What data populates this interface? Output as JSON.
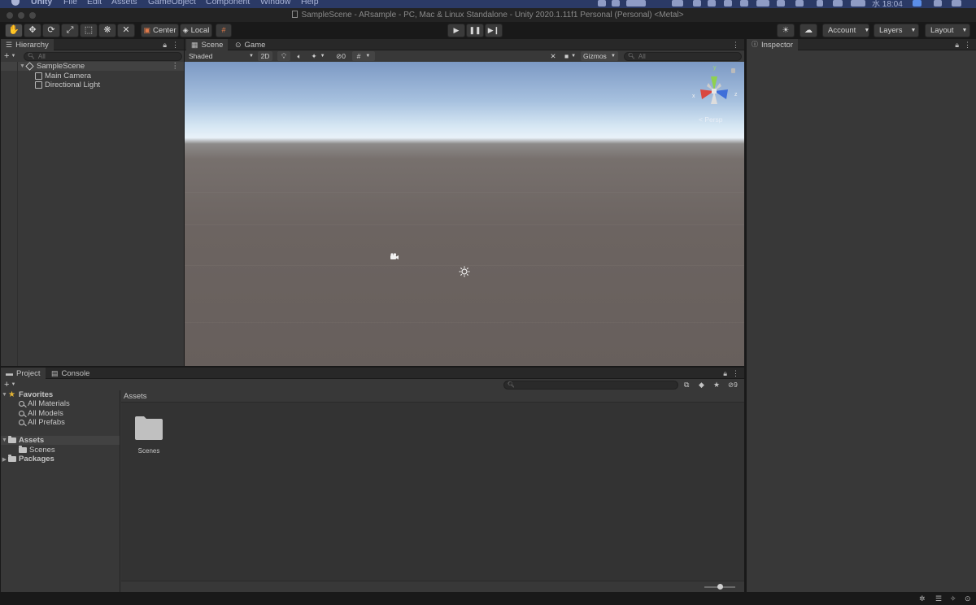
{
  "menubar": {
    "app_name": "Unity",
    "items": [
      "File",
      "Edit",
      "Assets",
      "GameObject",
      "Component",
      "Window",
      "Help"
    ],
    "clock": "水 18:04"
  },
  "window": {
    "title": "SampleScene - ARsample - PC, Mac & Linux Standalone - Unity 2020.1.11f1 Personal (Personal) <Metal>"
  },
  "toolbar": {
    "pivot_label": "Center",
    "space_label": "Local",
    "account_label": "Account",
    "layers_label": "Layers",
    "layout_label": "Layout"
  },
  "hierarchy": {
    "tab_label": "Hierarchy",
    "search_placeholder": "All",
    "scene_name": "SampleScene",
    "objects": [
      "Main Camera",
      "Directional Light"
    ]
  },
  "scene": {
    "scene_tab": "Scene",
    "game_tab": "Game",
    "draw_mode": "Shaded",
    "mode_2d": "2D",
    "hidden_count": "0",
    "gizmos_label": "Gizmos",
    "search_placeholder": "All",
    "persp_label": "< Persp",
    "axis_y": "y",
    "axis_x": "x",
    "axis_z": "z"
  },
  "inspector": {
    "tab_label": "Inspector"
  },
  "project": {
    "project_tab": "Project",
    "console_tab": "Console",
    "hidden_count": "9",
    "favorites_label": "Favorites",
    "favorites": [
      "All Materials",
      "All Models",
      "All Prefabs"
    ],
    "assets_label": "Assets",
    "asset_children": [
      "Scenes"
    ],
    "packages_label": "Packages",
    "breadcrumb": "Assets",
    "grid_items": [
      "Scenes"
    ],
    "thumb_size": 0.5
  }
}
